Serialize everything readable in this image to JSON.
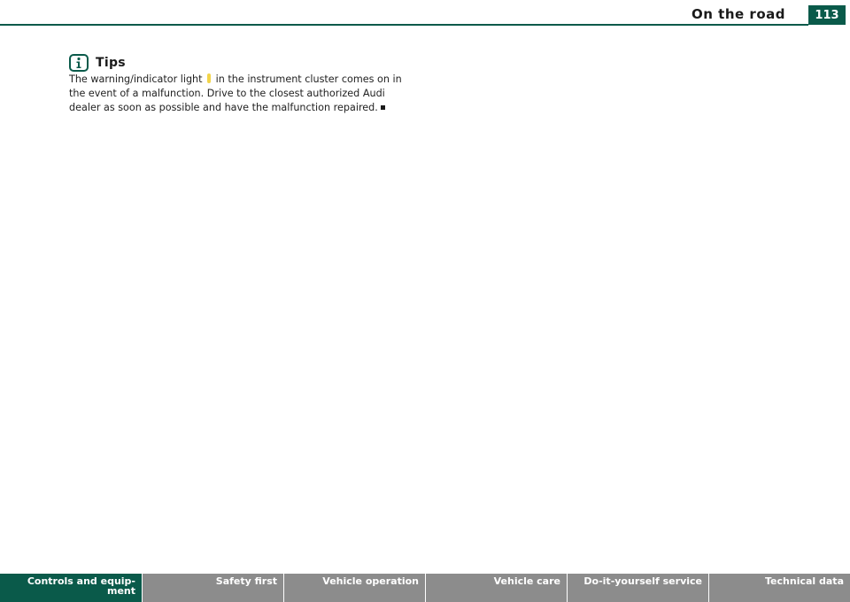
{
  "header": {
    "section_title": "On the road",
    "page_number": "113"
  },
  "tips": {
    "heading": "Tips",
    "text_before": "The warning/indicator light ",
    "text_after": " in the instrument cluster comes on in the event of a malfunction. Drive to the closest authorized Audi dealer as soon as possible and have the malfunction repaired.",
    "icon": "info-icon"
  },
  "footer": {
    "tabs": [
      {
        "label": "Controls and equip-\nment",
        "active": true
      },
      {
        "label": "Safety first",
        "active": false
      },
      {
        "label": "Vehicle operation",
        "active": false
      },
      {
        "label": "Vehicle care",
        "active": false
      },
      {
        "label": "Do-it-yourself service",
        "active": false
      },
      {
        "label": "Technical data",
        "active": false
      }
    ]
  },
  "colors": {
    "accent": "#0a5a4a",
    "tab_inactive": "#8c8c8c",
    "warning_light": "#f2d44a"
  }
}
